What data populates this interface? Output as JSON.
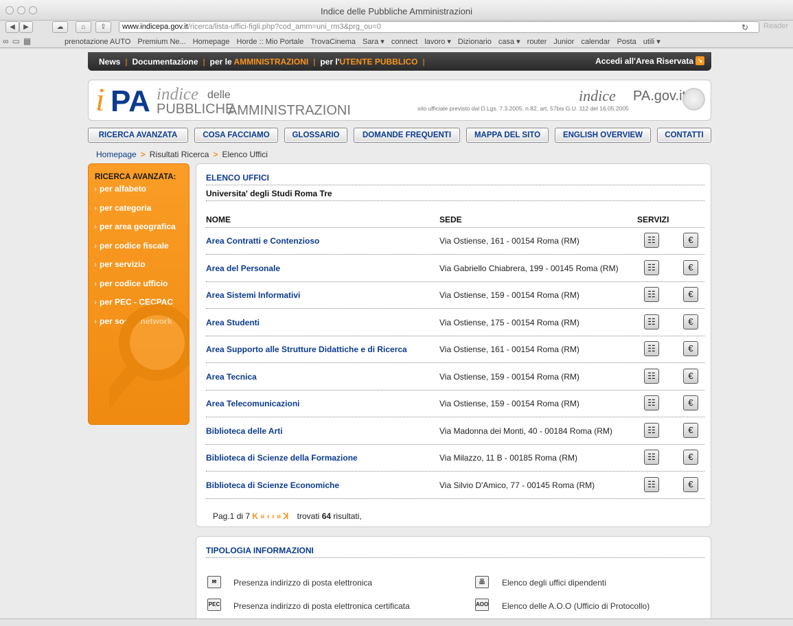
{
  "window": {
    "title": "Indice delle Pubbliche Amministrazioni"
  },
  "browser": {
    "url_host": "www.indicepa.gov.it",
    "url_path": "/ricerca/lista-uffici-figli.php?cod_amm=uni_rm3&prg_ou=0",
    "reader_label": "Reader",
    "bookmarks": [
      "prenotazione AUTO",
      "Premium Ne...",
      "Homepage",
      "Horde :: Mio Portale",
      "TrovaCinema",
      "Sara ▾",
      "connect",
      "lavoro ▾",
      "Dizionario",
      "casa ▾",
      "router",
      "Junior",
      "calendar",
      "Posta",
      "utili ▾"
    ]
  },
  "topnav": {
    "news": "News",
    "documentazione": "Documentazione",
    "per_le": "per le",
    "amministrazioni": "AMMINISTRAZIONI",
    "per_l": "per l'",
    "utente": "UTENTE PUBBLICO",
    "accedi": "Accedi all'Area Riservata"
  },
  "header": {
    "logo_i": "i",
    "logo_pa": "PA",
    "logo_indice": "indice",
    "logo_delle": "delle",
    "logo_pubbliche": "PUBBLICHE",
    "logo_amministrazioni": "AMMINISTRAZIONI",
    "site_indice": "indice",
    "site_pa": "PA.gov.it",
    "tagline": "sito ufficiale previsto dal D.Lgs. 7.3.2005. n.82, art. 57bis G.U. 112 del 16.05.2005"
  },
  "mainnav": [
    "RICERCA AVANZATA",
    "COSA FACCIAMO",
    "GLOSSARIO",
    "DOMANDE FREQUENTI",
    "MAPPA DEL SITO",
    "ENGLISH OVERVIEW",
    "CONTATTI"
  ],
  "breadcrumb": [
    "Homepage",
    "Risultati Ricerca",
    "Elenco Uffici"
  ],
  "sidebar": {
    "title": "RICERCA AVANZATA:",
    "items": [
      "per alfabeto",
      "per categoria",
      "per area geografica",
      "per codice fiscale",
      "per servizio",
      "per codice ufficio",
      "per PEC - CECPAC",
      "per social network"
    ]
  },
  "offices": {
    "title": "ELENCO UFFICI",
    "entity": "Universita' degli Studi Roma Tre",
    "col_nome": "NOME",
    "col_sede": "SEDE",
    "col_servizi": "SERVIZI",
    "rows": [
      {
        "name": "Area Contratti e Contenzioso",
        "sede": "Via Ostiense, 161 - 00154 Roma (RM)"
      },
      {
        "name": "Area del Personale",
        "sede": "Via Gabriello Chiabrera, 199 - 00145 Roma (RM)"
      },
      {
        "name": "Area Sistemi Informativi",
        "sede": "Via Ostiense, 159 - 00154 Roma (RM)"
      },
      {
        "name": "Area Studenti",
        "sede": "Via Ostiense, 175 - 00154 Roma (RM)"
      },
      {
        "name": "Area Supporto alle Strutture Didattiche e di Ricerca",
        "sede": "Via Ostiense, 161 - 00154 Roma (RM)"
      },
      {
        "name": "Area Tecnica",
        "sede": "Via Ostiense, 159 - 00154 Roma (RM)"
      },
      {
        "name": "Area Telecomunicazioni",
        "sede": "Via Ostiense, 159 - 00154 Roma (RM)"
      },
      {
        "name": "Biblioteca delle Arti",
        "sede": "Via Madonna dei Monti, 40 - 00184 Roma (RM)"
      },
      {
        "name": "Biblioteca di Scienze della Formazione",
        "sede": "Via Milazzo, 11 B - 00185 Roma (RM)"
      },
      {
        "name": "Biblioteca di Scienze Economiche",
        "sede": "Via Silvio D'Amico, 77 - 00145 Roma (RM)"
      }
    ],
    "pager": {
      "page_text": "Pag.1 di 7",
      "found_prefix": "trovati",
      "found_count": "64",
      "found_suffix": "risultati,"
    }
  },
  "legend": {
    "title": "TIPOLOGIA INFORMAZIONI",
    "items": [
      {
        "icon": "✉",
        "text": "Presenza indirizzo di posta elettronica"
      },
      {
        "icon": "品",
        "text": "Elenco degli uffici dipendenti"
      },
      {
        "icon": "PEC",
        "text": "Presenza indirizzo di posta elettronica certificata"
      },
      {
        "icon": "AOO",
        "text": "Elenco delle A.O.O (Ufficio di Protocollo)"
      }
    ]
  },
  "colors": {
    "accent_orange": "#f7941d",
    "link_blue": "#0b3b8f",
    "nav_dark": "#333333"
  }
}
